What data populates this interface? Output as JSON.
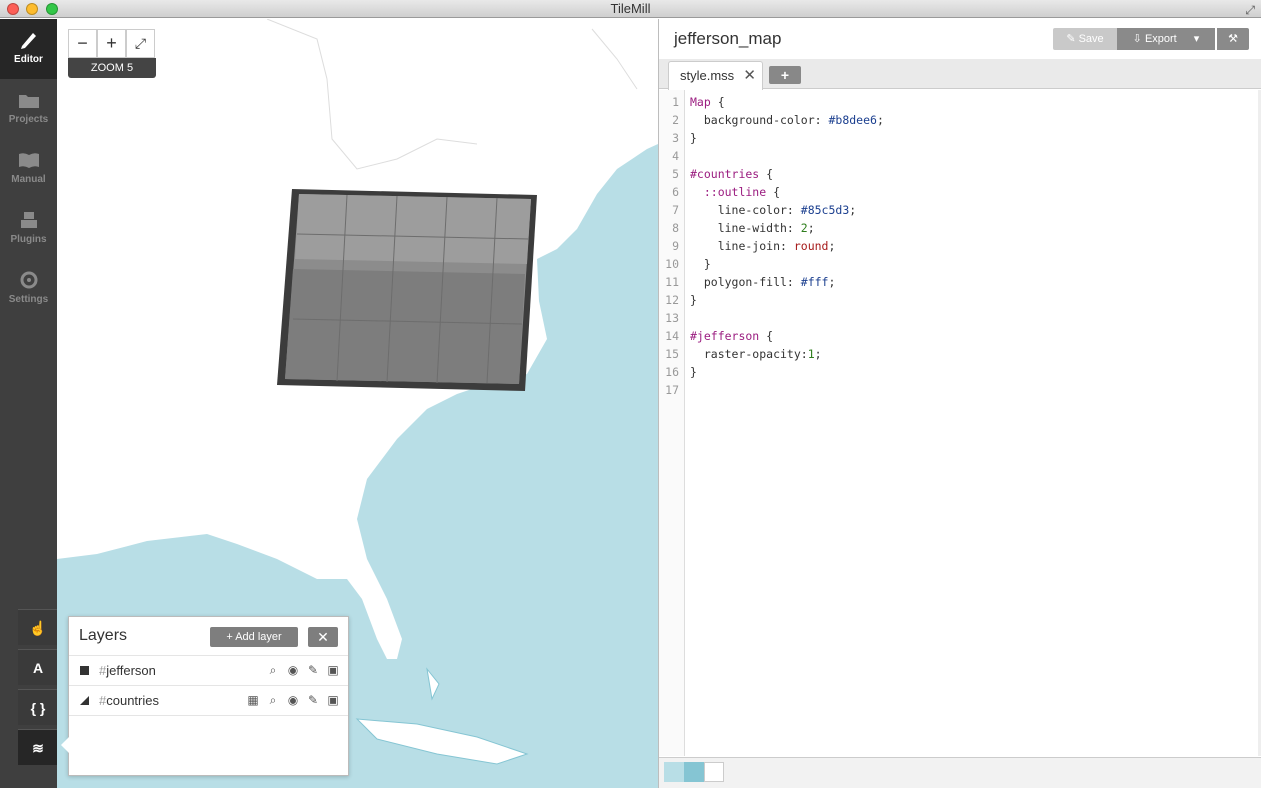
{
  "window": {
    "title": "TileMill"
  },
  "nav": {
    "items": [
      {
        "label": "Editor",
        "icon": "pencil-icon"
      },
      {
        "label": "Projects",
        "icon": "folder-icon"
      },
      {
        "label": "Manual",
        "icon": "book-icon"
      },
      {
        "label": "Plugins",
        "icon": "plugin-icon"
      },
      {
        "label": "Settings",
        "icon": "gear-icon"
      }
    ],
    "tools": [
      {
        "label": "☝",
        "name": "pointer-tool"
      },
      {
        "label": "A",
        "name": "text-tool"
      },
      {
        "label": "{ }",
        "name": "code-tool"
      },
      {
        "label": "≋",
        "name": "layers-tool"
      }
    ]
  },
  "map": {
    "zoom_out": "−",
    "zoom_in": "+",
    "fullscreen": "⤢",
    "zoom_label": "ZOOM 5",
    "colors": {
      "water": "#b8dee6",
      "land": "#ffffff",
      "border": "#85c5d3"
    }
  },
  "layers": {
    "title": "Layers",
    "add_label": "Add layer",
    "close_label": "✕",
    "items": [
      {
        "hash": "#",
        "name": "jefferson"
      },
      {
        "hash": "#",
        "name": "countries"
      }
    ]
  },
  "editor": {
    "project_title": "jefferson_map",
    "save_label": "Save",
    "export_label": "Export",
    "tab_label": "style.mss",
    "tab_close": "✕",
    "add_tab": "+",
    "lines": [
      "1",
      "2",
      "3",
      "4",
      "5",
      "6",
      "7",
      "8",
      "9",
      "10",
      "11",
      "12",
      "13",
      "14",
      "15",
      "16",
      "17"
    ],
    "code": {
      "l1a": "Map",
      "l1b": " {",
      "l2a": "  background-color: ",
      "l2b": "#b8dee6",
      "l2c": ";",
      "l3": "}",
      "l5a": "#countries",
      "l5b": " {",
      "l6a": "  ::outline",
      "l6b": " {",
      "l7a": "    line-color: ",
      "l7b": "#85c5d3",
      "l7c": ";",
      "l8a": "    line-width: ",
      "l8b": "2",
      "l8c": ";",
      "l9a": "    line-join: ",
      "l9b": "round",
      "l9c": ";",
      "l10": "  }",
      "l11a": "  polygon-fill: ",
      "l11b": "#fff",
      "l11c": ";",
      "l12": "}",
      "l14a": "#jefferson",
      "l14b": " {",
      "l15a": "  raster-opacity:",
      "l15b": "1",
      "l15c": ";",
      "l16": "}"
    },
    "swatches": [
      "#b8dee6",
      "#85c5d3",
      "#ffffff"
    ]
  }
}
